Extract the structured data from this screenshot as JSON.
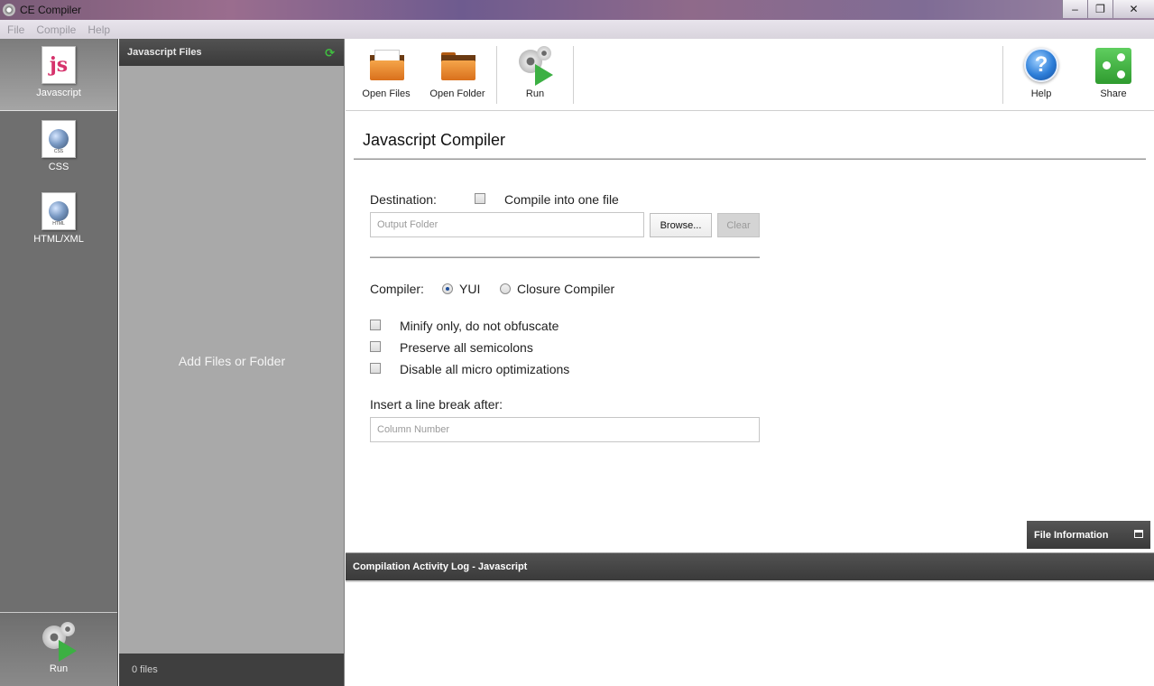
{
  "window": {
    "title": "CE Compiler",
    "minimize": "‒",
    "restore": "❐",
    "close": "✕"
  },
  "menu": [
    "File",
    "Compile",
    "Help"
  ],
  "nav": {
    "items": [
      {
        "label": "Javascript",
        "active": true,
        "badge": "JS"
      },
      {
        "label": "CSS",
        "active": false,
        "badge": "CSS"
      },
      {
        "label": "HTML/XML",
        "active": false,
        "badge": "HTML"
      }
    ],
    "run_label": "Run"
  },
  "files": {
    "header": "Javascript Files",
    "placeholder": "Add Files or Folder",
    "count": "0 files"
  },
  "toolbar": {
    "open_files": "Open Files",
    "open_folder": "Open Folder",
    "run": "Run",
    "help": "Help",
    "share": "Share"
  },
  "main": {
    "title": "Javascript Compiler",
    "destination_label": "Destination:",
    "compile_one_file": "Compile into one file",
    "output_placeholder": "Output Folder",
    "browse": "Browse...",
    "clear": "Clear",
    "compiler_label": "Compiler:",
    "compiler_options": [
      "YUI",
      "Closure Compiler"
    ],
    "selected_compiler": "YUI",
    "options": [
      "Minify only, do not obfuscate",
      "Preserve all semicolons",
      "Disable all micro optimizations"
    ],
    "linebreak_label": "Insert a line break after:",
    "column_placeholder": "Column Number",
    "file_info": "File Information"
  },
  "log": {
    "header": "Compilation Activity Log - Javascript"
  },
  "colors": {
    "accent_green": "#3cb043",
    "panel_dark": "#3f3f3f",
    "nav_gray": "#6f6f6f"
  }
}
